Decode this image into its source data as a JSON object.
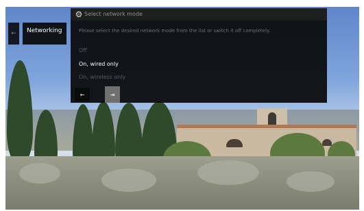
{
  "sidebar": {
    "prev_label": "←",
    "active_tab": "Networking"
  },
  "dialog": {
    "icon": "gear-icon",
    "title": "Select network mode",
    "description": "Please select the desired network mode from the list or switch it off completely.",
    "options": [
      {
        "label": "Off",
        "selected": false
      },
      {
        "label": "On, wired only",
        "selected": true
      },
      {
        "label": "On, wireless only",
        "selected": false
      }
    ],
    "back_label": "←",
    "forward_label": "⇥"
  },
  "colors": {
    "panel": "#0a0a0a",
    "header": "#202020",
    "selected_text": "#ffffff",
    "dimmed_text": "#5d5d5d",
    "active_button": "#707070"
  }
}
